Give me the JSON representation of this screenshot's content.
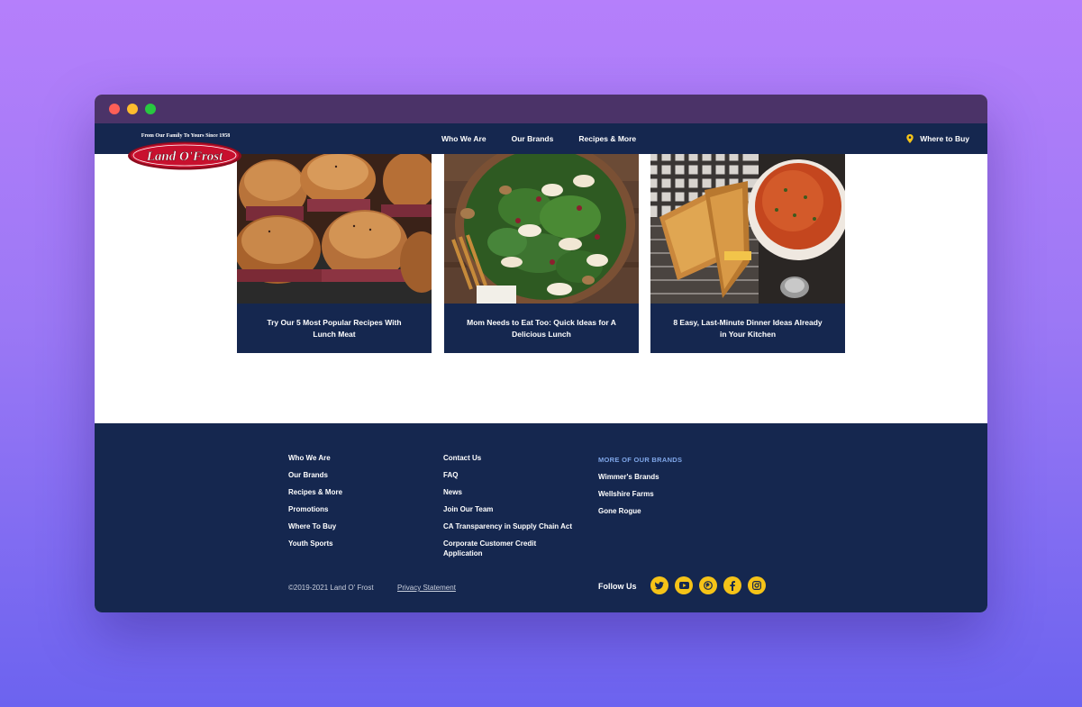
{
  "nav": {
    "logo_tagline": "From Our Family To Yours Since 1958",
    "logo_brand": "Land O'Frost",
    "links": [
      "Who We Are",
      "Our Brands",
      "Recipes & More"
    ],
    "where_to_buy": "Where to Buy"
  },
  "cards": [
    {
      "title": "Try Our 5 Most Popular Recipes With Lunch Meat",
      "image": "sliders-photo"
    },
    {
      "title": "Mom Needs to Eat Too: Quick Ideas for A Delicious Lunch",
      "image": "salad-photo"
    },
    {
      "title": "8 Easy, Last-Minute Dinner Ideas Already in Your Kitchen",
      "image": "grilled-cheese-soup-photo"
    }
  ],
  "footer": {
    "col1": [
      "Who We Are",
      "Our Brands",
      "Recipes & More",
      "Promotions",
      "Where To Buy",
      "Youth Sports"
    ],
    "col2": [
      "Contact Us",
      "FAQ",
      "News",
      "Join Our Team",
      "CA Transparency in Supply Chain Act",
      "Corporate Customer Credit Application"
    ],
    "brands_heading": "MORE OF OUR BRANDS",
    "brands": [
      "Wimmer's Brands",
      "Wellshire Farms",
      "Gone Rogue"
    ],
    "copyright": "©2019-2021 Land O' Frost",
    "privacy": "Privacy Statement",
    "follow_us": "Follow Us",
    "social_icons": [
      "twitter-icon",
      "youtube-icon",
      "pinterest-icon",
      "facebook-icon",
      "instagram-icon"
    ]
  },
  "colors": {
    "navy": "#15274f",
    "accent_yellow": "#f5c318",
    "brand_heading": "#7fa6e8",
    "logo_red": "#c8102e"
  }
}
